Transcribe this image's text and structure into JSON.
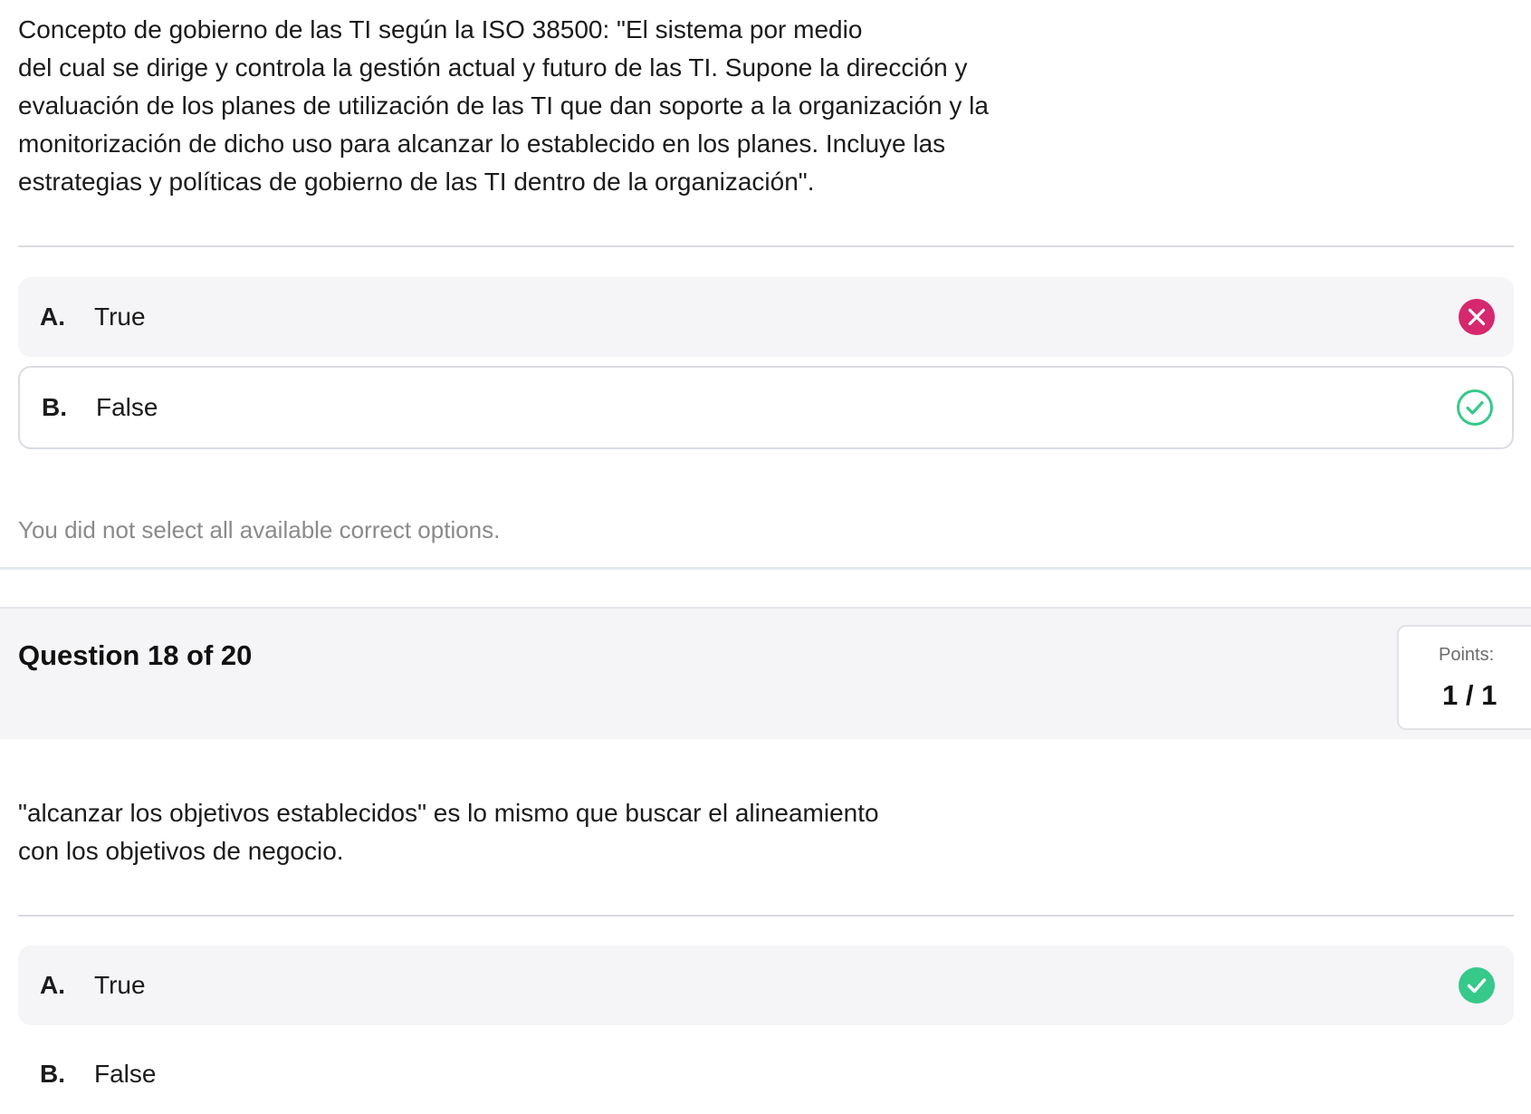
{
  "previous_question": {
    "text_lines": [
      "Concepto de gobierno de las TI según la ISO 38500: \"El sistema por medio",
      "del cual se dirige y controla la gestión actual y futuro de las TI. Supone la dirección y",
      "evaluación de los planes de utilización de las TI que dan soporte a la organización y la",
      "monitorización de dicho uso para alcanzar lo establecido en los planes. Incluye las",
      "estrategias y políticas de gobierno de las TI dentro de la organización\"."
    ],
    "options": [
      {
        "letter": "A.",
        "label": "True",
        "icon": "x-circle-icon",
        "icon_color": "#d6286e"
      },
      {
        "letter": "B.",
        "label": "False",
        "icon": "check-circle-outline-icon",
        "icon_color": "#36c98a"
      }
    ],
    "feedback": "You did not select all available correct options."
  },
  "current_question": {
    "title": "Question 18 of 20",
    "points_label": "Points:",
    "points_value": "1 / 1",
    "text_lines": [
      "\"alcanzar los objetivos establecidos\" es lo mismo que buscar el alineamiento",
      "con los objetivos de negocio."
    ],
    "options": [
      {
        "letter": "A.",
        "label": "True",
        "icon": "check-circle-filled-icon",
        "icon_color": "#36c98a"
      },
      {
        "letter": "B.",
        "label": "False"
      }
    ]
  }
}
